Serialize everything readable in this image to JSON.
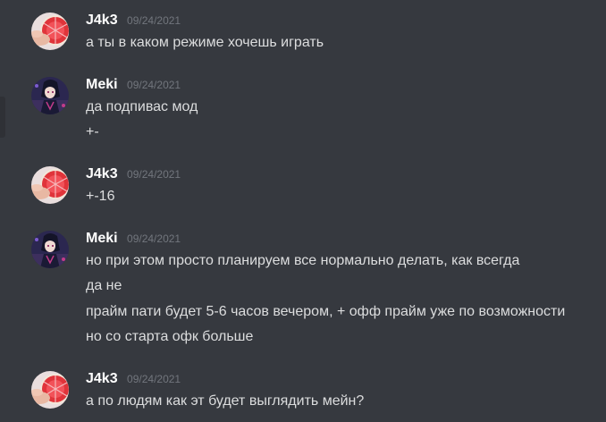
{
  "colors": {
    "background": "#36393f",
    "username": "#ffffff",
    "timestamp": "#72767d",
    "message_text": "#dcddde"
  },
  "messages": [
    {
      "author": "J4k3",
      "avatar": "grapefruit-avatar",
      "timestamp": "09/24/2021",
      "lines": [
        "а ты в каком режиме хочешь играть"
      ]
    },
    {
      "author": "Meki",
      "avatar": "anime-character-avatar",
      "timestamp": "09/24/2021",
      "lines": [
        "да подпивас мод",
        "+-"
      ]
    },
    {
      "author": "J4k3",
      "avatar": "grapefruit-avatar",
      "timestamp": "09/24/2021",
      "lines": [
        "+-16"
      ]
    },
    {
      "author": "Meki",
      "avatar": "anime-character-avatar",
      "timestamp": "09/24/2021",
      "lines": [
        "но при этом просто планируем все нормально делать, как всегда",
        "да не",
        "прайм пати будет 5-6 часов вечером, + офф прайм уже по возможности",
        "но со старта офк больше"
      ]
    },
    {
      "author": "J4k3",
      "avatar": "grapefruit-avatar",
      "timestamp": "09/24/2021",
      "lines": [
        "а по людям как эт будет выглядить мейн?"
      ]
    }
  ]
}
